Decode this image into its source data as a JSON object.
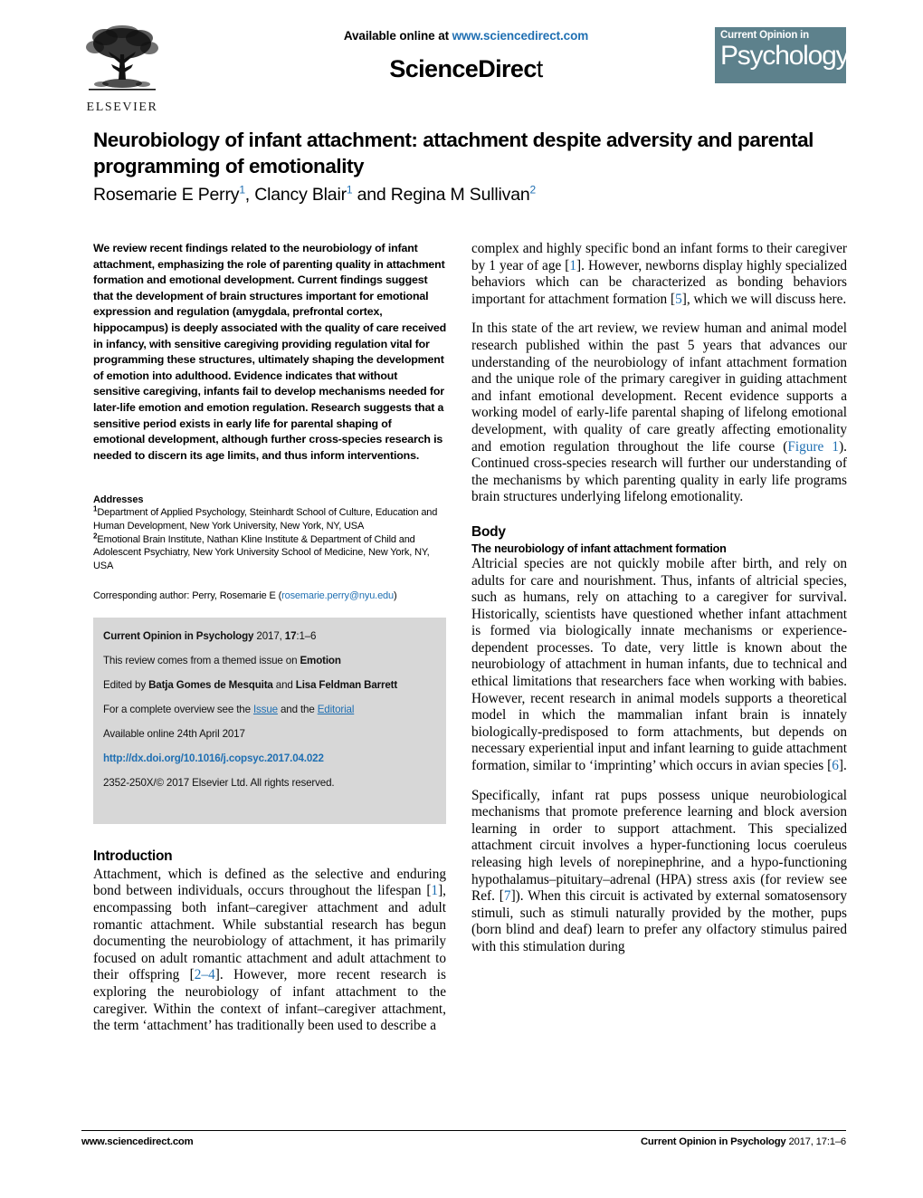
{
  "masthead": {
    "available_prefix": "Available online at ",
    "available_url_text": "www.sciencedirect.com",
    "wordmark_bold": "ScienceDirec",
    "wordmark_thin": "t",
    "elsevier_name": "ELSEVIER",
    "journal_badge_line1": "Current Opinion in",
    "journal_badge_line2": "Psychology"
  },
  "title": {
    "line1": "Neurobiology of infant attachment: attachment despite adversity",
    "line2": "and parental programming of emotionality",
    "authors": {
      "a1_name": "Rosemarie E Perry",
      "a1_sup": "1",
      "sep1": ", ",
      "a2_name": "Clancy Blair",
      "a2_sup": "1",
      "sep2": " and ",
      "a3_name": "Regina M Sullivan",
      "a3_sup": "2"
    }
  },
  "abstract": {
    "text": "We review recent findings related to the neurobiology of infant attachment, emphasizing the role of parenting quality in attachment formation and emotional development. Current findings suggest that the development of brain structures important for emotional expression and regulation (amygdala, prefrontal cortex, hippocampus) is deeply associated with the quality of care received in infancy, with sensitive caregiving providing regulation vital for programming these structures, ultimately shaping the development of emotion into adulthood. Evidence indicates that without sensitive caregiving, infants fail to develop mechanisms needed for later-life emotion and emotion regulation. Research suggests that a sensitive period exists in early life for parental shaping of emotional development, although further cross-species research is needed to discern its age limits, and thus inform interventions."
  },
  "addresses": {
    "heading": "Addresses",
    "items": [
      {
        "sup": "1",
        "text": "Department of Applied Psychology, Steinhardt School of Culture, Education and Human Development, New York University, New York, NY, USA"
      },
      {
        "sup": "2",
        "text": "Emotional Brain Institute, Nathan Kline Institute & Department of Child and Adolescent Psychiatry, New York University School of Medicine, New York, NY, USA"
      }
    ],
    "corresponding_prefix": "Corresponding author: Perry, Rosemarie E (",
    "corresponding_email": "rosemarie.perry@nyu.edu",
    "corresponding_suffix": ")"
  },
  "infobox": {
    "citation_journal": "Current Opinion in Psychology",
    "citation_rest_pre": " 2017, ",
    "citation_volume": "17",
    "citation_rest_post": ":1–6",
    "themed_pre": "This review comes from a themed issue on ",
    "themed_topic": "Emotion",
    "edited_pre": "Edited by ",
    "editor1": "Batja Gomes de Mesquita",
    "edited_mid": " and ",
    "editor2": "Lisa Feldman Barrett",
    "overview_pre": "For a complete overview see the ",
    "overview_link1": "Issue",
    "overview_mid": " and the ",
    "overview_link2": "Editorial",
    "available_online": "Available online 24th April 2017",
    "doi": "http://dx.doi.org/10.1016/j.copsyc.2017.04.022",
    "copyright": "2352-250X/© 2017 Elsevier Ltd. All rights reserved."
  },
  "left_column": {
    "intro_heading": "Introduction",
    "intro_p1_a": "Attachment, which is defined as the selective and enduring bond between individuals, occurs throughout the lifespan [",
    "intro_ref1": "1",
    "intro_p1_b": "], encompassing both infant–caregiver attachment and adult romantic attachment. While substantial research has begun documenting the neurobiology of attachment, it has primarily focused on adult romantic attachment and adult attachment to their offspring [",
    "intro_ref2": "2–4",
    "intro_p1_c": "]. However, more recent research is exploring the neurobiology of infant attachment to the caregiver. Within the context of infant–caregiver attachment, the term ‘attachment’ has traditionally been used to describe a"
  },
  "right_column": {
    "p1_a": "complex and highly specific bond an infant forms to their caregiver by 1 year of age [",
    "p1_ref1": "1",
    "p1_b": "]. However, newborns display highly specialized behaviors which can be characterized as bonding behaviors important for attachment formation [",
    "p1_ref2": "5",
    "p1_c": "], which we will discuss here.",
    "p2_a": "In this state of the art review, we review human and animal model research published within the past 5 years that advances our understanding of the neurobiology of infant attachment formation and the unique role of the primary caregiver in guiding attachment and infant emotional development. Recent evidence supports a working model of early-life parental shaping of lifelong emotional development, with quality of care greatly affecting emotionality and emotion regulation throughout the life course (",
    "p2_figref": "Figure 1",
    "p2_b": "). Continued cross-species research will further our understanding of the mechanisms by which parenting quality in early life programs brain structures underlying lifelong emotionality.",
    "body_heading": "Body",
    "body_subheading": "The neurobiology of infant attachment formation",
    "p3_a": "Altricial species are not quickly mobile after birth, and rely on adults for care and nourishment. Thus, infants of altricial species, such as humans, rely on attaching to a caregiver for survival. Historically, scientists have questioned whether infant attachment is formed via biologically innate mechanisms or experience-dependent processes. To date, very little is known about the neurobiology of attachment in human infants, due to technical and ethical limitations that researchers face when working with babies. However, recent research in animal models supports a theoretical model in which the mammalian infant brain is innately biologically-predisposed to form attachments, but depends on necessary experiential input and infant learning to guide attachment formation, similar to ‘imprinting’ which occurs in avian species [",
    "p3_ref": "6",
    "p3_b": "].",
    "p4_a": "Specifically, infant rat pups possess unique neurobiological mechanisms that promote preference learning and block aversion learning in order to support attachment. This specialized attachment circuit involves a hyper-functioning locus coeruleus releasing high levels of norepinephrine, and a hypo-functioning hypothalamus–pituitary–adrenal (HPA) stress axis (for review see Ref. [",
    "p4_ref": "7",
    "p4_b": "]). When this circuit is activated by external somatosensory stimuli, such as stimuli naturally provided by the mother, pups (born blind and deaf) learn to prefer any olfactory stimulus paired with this stimulation during"
  },
  "footer": {
    "left": "www.sciencedirect.com",
    "right_journal": "Current Opinion in Psychology",
    "right_rest": " 2017, 17:1–6"
  },
  "colors": {
    "link_blue": "#1f6fb2",
    "badge_teal": "#5d818c",
    "infobox_gray": "#d7d7d7"
  }
}
